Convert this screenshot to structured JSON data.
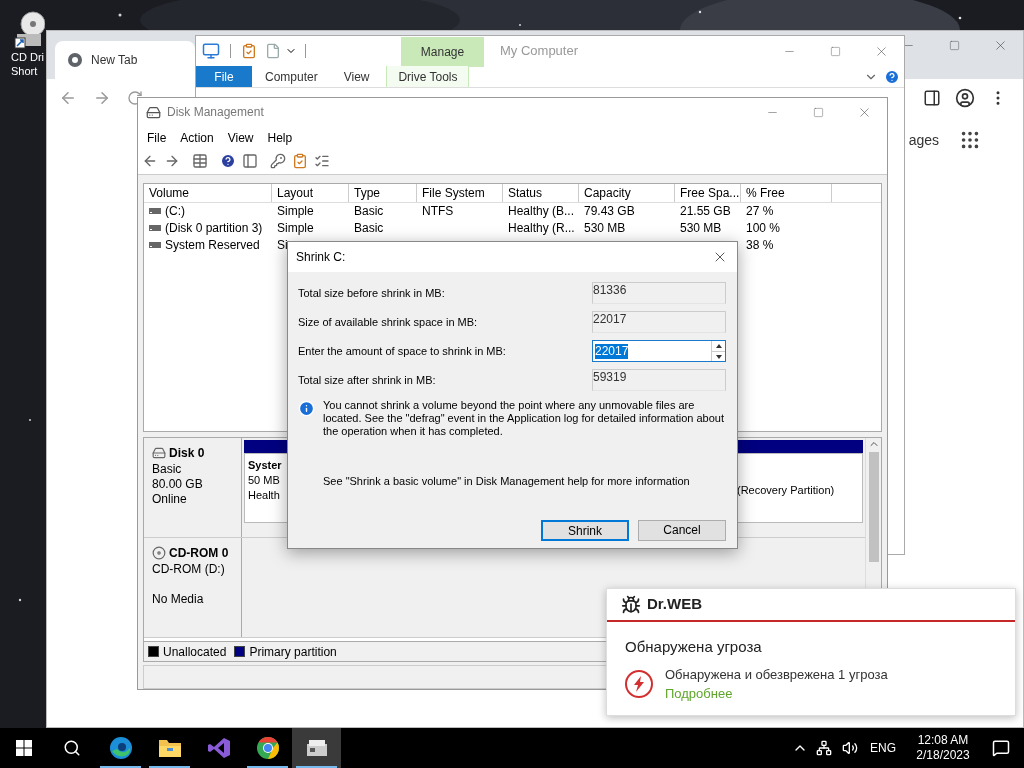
{
  "desktop": {
    "icons": [
      {
        "lines": [
          "CD Dri",
          "Short"
        ]
      }
    ]
  },
  "browser": {
    "tab_title": "New Tab",
    "partial_link": "ages"
  },
  "explorer": {
    "title": "My Computer",
    "context_group": "Manage",
    "ribbon_tabs": [
      {
        "label": "File",
        "kind": "file"
      },
      {
        "label": "Computer",
        "kind": "tab"
      },
      {
        "label": "View",
        "kind": "tab"
      },
      {
        "label": "Drive Tools",
        "kind": "context"
      }
    ]
  },
  "disk_management": {
    "title": "Disk Management",
    "menu": [
      "File",
      "Action",
      "View",
      "Help"
    ],
    "columns": [
      "Volume",
      "Layout",
      "Type",
      "File System",
      "Status",
      "Capacity",
      "Free Spa...",
      "% Free"
    ],
    "rows": [
      {
        "volume": "(C:)",
        "layout": "Simple",
        "type": "Basic",
        "file_system": "NTFS",
        "status": "Healthy (B...",
        "capacity": "79.43 GB",
        "free_space": "21.55 GB",
        "percent_free": "27 %"
      },
      {
        "volume": "(Disk 0 partition 3)",
        "layout": "Simple",
        "type": "Basic",
        "status": "Healthy (R...",
        "capacity": "530 MB",
        "free_space": "530 MB",
        "percent_free": "100 %"
      },
      {
        "volume": "System Reserved",
        "layout": "Si",
        "percent_free": "38 %"
      }
    ],
    "disks": [
      {
        "kind": "disk",
        "name": "Disk 0",
        "info": [
          "Basic",
          "80.00 GB"
        ],
        "status": "Online",
        "partitions": [
          {
            "lines": [
              "Syster",
              "50 MB",
              "Health"
            ]
          },
          {
            "lines": [
              "(Recovery Partition)"
            ]
          }
        ]
      },
      {
        "kind": "cdrom",
        "name": "CD-ROM 0",
        "info": [
          "CD-ROM (D:)"
        ],
        "status": "No Media"
      }
    ],
    "legend": [
      {
        "label": "Unallocated",
        "color": "#000000"
      },
      {
        "label": "Primary partition",
        "color": "#000080"
      }
    ]
  },
  "dialog": {
    "title": "Shrink C:",
    "fields": [
      {
        "label": "Total size before shrink in MB:",
        "value": "81336",
        "kind": "readonly"
      },
      {
        "label": "Size of available shrink space in MB:",
        "value": "22017",
        "kind": "readonly"
      },
      {
        "label": "Enter the amount of space to shrink in MB:",
        "value": "22017",
        "kind": "spin"
      },
      {
        "label": "Total size after shrink in MB:",
        "value": "59319",
        "kind": "readonly"
      }
    ],
    "info": "You cannot shrink a volume beyond the point where any unmovable files are located. See the \"defrag\" event in the Application log for detailed information about the operation when it has completed.",
    "help": "See \"Shrink a basic volume\" in Disk Management help for more information",
    "buttons": [
      {
        "label": "Shrink",
        "default": true
      },
      {
        "label": "Cancel",
        "default": false
      }
    ]
  },
  "notification": {
    "brand": "Dr.WEB",
    "title": "Обнаружена угроза",
    "message": "Обнаружена и обезврежена 1 угроза",
    "link": "Подробнее"
  },
  "taskbar": {
    "apps": [
      {
        "kind": "edge",
        "running": true,
        "selected": false
      },
      {
        "kind": "folder",
        "running": true,
        "selected": false
      },
      {
        "kind": "studio",
        "running": false,
        "selected": false
      },
      {
        "kind": "chrome",
        "running": true,
        "selected": false
      },
      {
        "kind": "disk",
        "running": true,
        "selected": true
      }
    ],
    "language": "ENG",
    "time": "12:08 AM",
    "date": "2/18/2023"
  }
}
